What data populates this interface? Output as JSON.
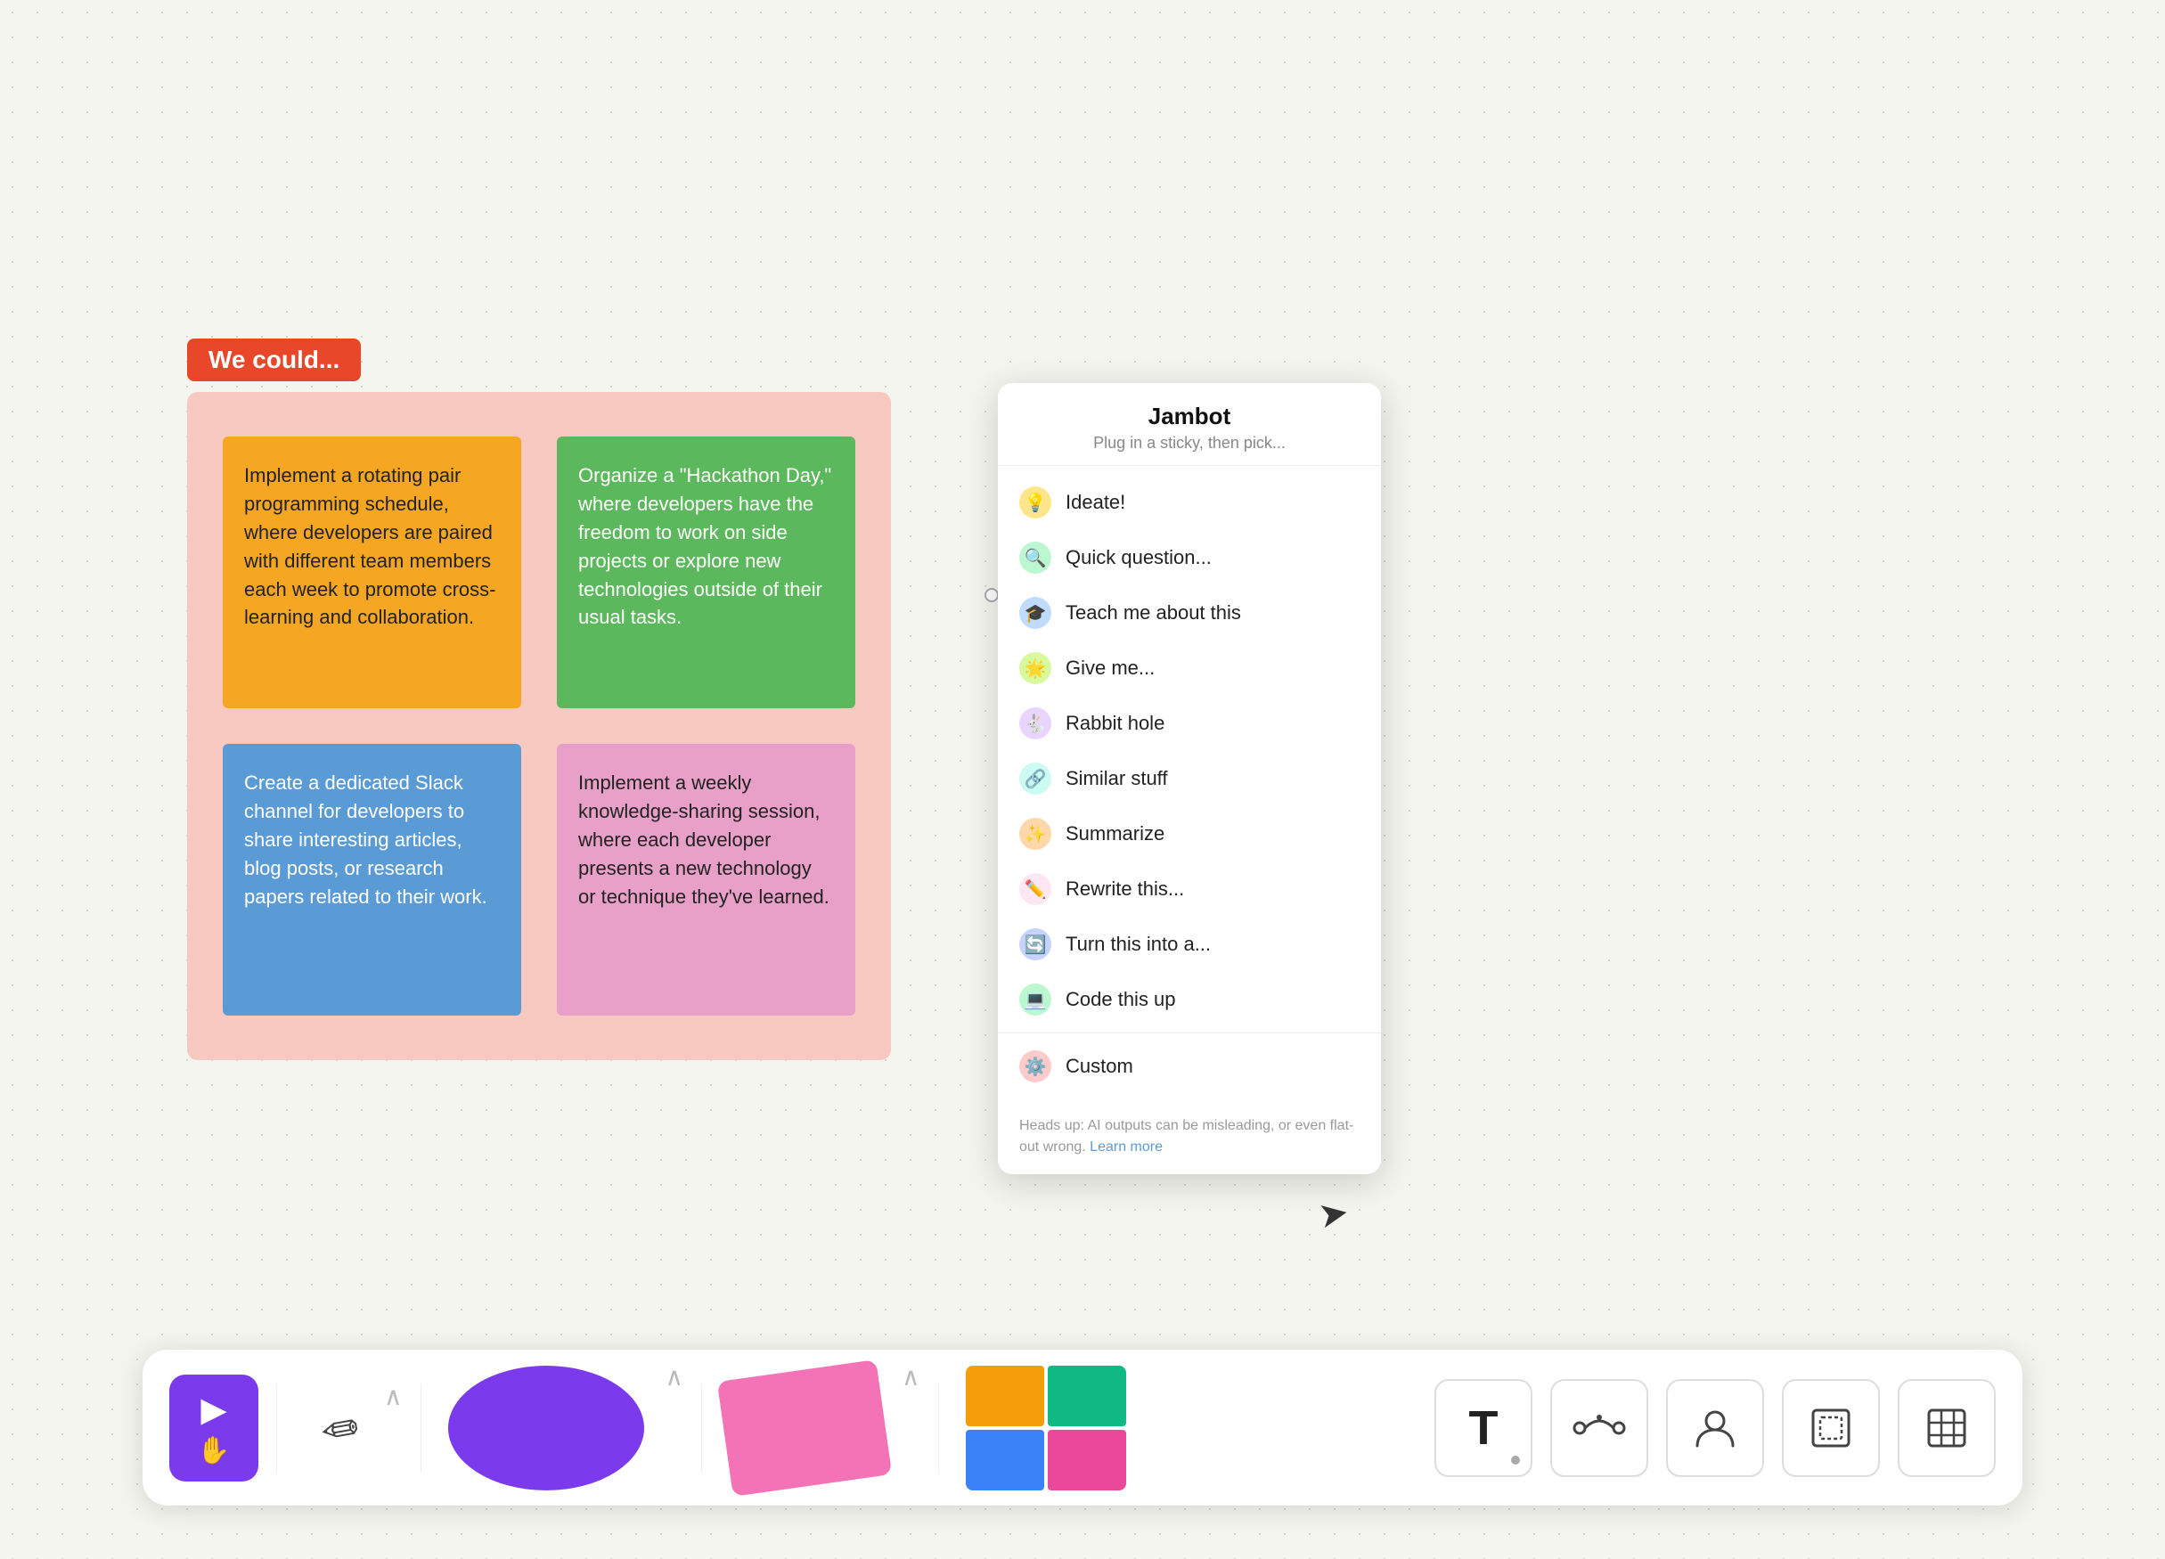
{
  "frame": {
    "label": "We could...",
    "background_color": "#f8c9c0"
  },
  "stickies": [
    {
      "id": "sticky-1",
      "color": "orange",
      "text": "Implement a rotating pair programming schedule, where developers are paired with different team members each week to promote cross-learning and collaboration."
    },
    {
      "id": "sticky-2",
      "color": "green",
      "text": "Organize a \"Hackathon Day,\" where developers have the freedom to work on side projects or explore new technologies outside of their usual tasks."
    },
    {
      "id": "sticky-3",
      "color": "blue",
      "text": "Create a dedicated Slack channel for developers to share interesting articles, blog posts, or research papers related to their work."
    },
    {
      "id": "sticky-4",
      "color": "pink",
      "text": "Implement a weekly knowledge-sharing session, where each developer presents a new technology or technique they've learned."
    }
  ],
  "jambot": {
    "title": "Jambot",
    "subtitle": "Plug in a sticky, then pick...",
    "menu_items": [
      {
        "id": "ideate",
        "label": "Ideate!",
        "icon": "💡",
        "icon_class": "icon-yellow"
      },
      {
        "id": "quick-question",
        "label": "Quick question...",
        "icon": "🔍",
        "icon_class": "icon-green"
      },
      {
        "id": "teach-me",
        "label": "Teach me about this",
        "icon": "🎓",
        "icon_class": "icon-blue"
      },
      {
        "id": "give-me",
        "label": "Give me...",
        "icon": "🌟",
        "icon_class": "icon-lime"
      },
      {
        "id": "rabbit-hole",
        "label": "Rabbit hole",
        "icon": "🐇",
        "icon_class": "icon-purple"
      },
      {
        "id": "similar-stuff",
        "label": "Similar stuff",
        "icon": "🔗",
        "icon_class": "icon-teal"
      },
      {
        "id": "summarize",
        "label": "Summarize",
        "icon": "✨",
        "icon_class": "icon-orange"
      },
      {
        "id": "rewrite",
        "label": "Rewrite this...",
        "icon": "✏️",
        "icon_class": "icon-pink"
      },
      {
        "id": "turn-into",
        "label": "Turn this into a...",
        "icon": "🔄",
        "icon_class": "icon-indigo"
      },
      {
        "id": "code-this-up",
        "label": "Code this up",
        "icon": "💻",
        "icon_class": "icon-green"
      },
      {
        "id": "custom",
        "label": "Custom",
        "icon": "⚙️",
        "icon_class": "icon-red"
      }
    ],
    "footer": "Heads up: AI outputs can be misleading, or even flat-out wrong.",
    "footer_link": "Learn more"
  },
  "toolbar": {
    "select_label": "▶",
    "hand_label": "✋",
    "pencil_label": "✏",
    "text_label": "T",
    "connector_label": "⌒",
    "expand_label": "∧",
    "shape_label": "□",
    "table_label": "⊞",
    "sticky_label": "🗒",
    "avatar_label": "👤",
    "frame_label": "⬜"
  }
}
